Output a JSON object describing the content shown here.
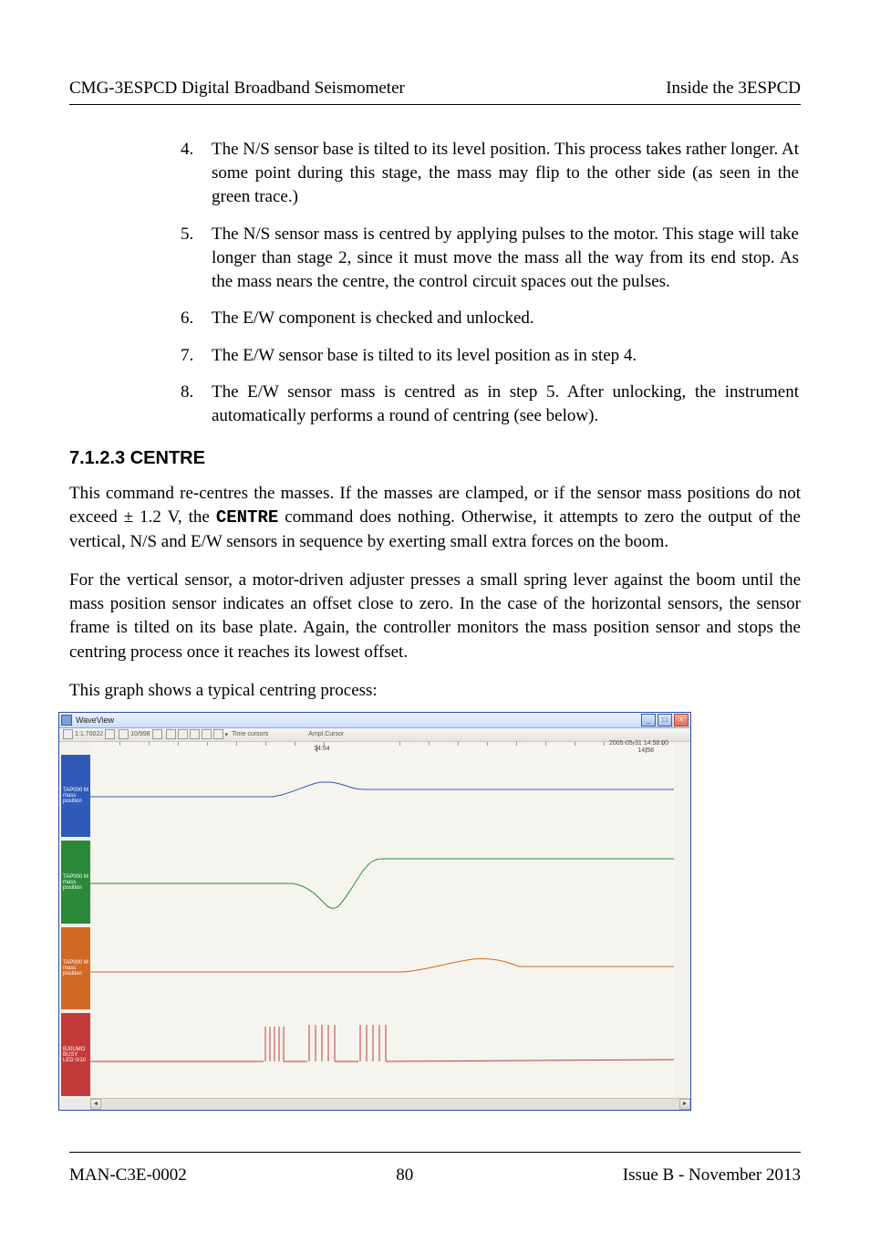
{
  "header": {
    "left": "CMG-3ESPCD Digital Broadband Seismometer",
    "right": "Inside the 3ESPCD"
  },
  "steps": {
    "s4": "The N/S sensor base is tilted to its level position. This process takes rather longer.  At some point during this stage, the mass may flip to the other side (as seen in the green trace.)",
    "s5": "The N/S sensor mass is centred by applying pulses to the motor.  This stage will take longer than stage 2, since it must move the mass all the way from its end stop.  As the mass nears the centre, the control circuit spaces out the pulses.",
    "s6": "The E/W component is checked and unlocked.",
    "s7": "The E/W sensor base is tilted to its level position as in step 4.",
    "s8": "The E/W sensor mass is centred as in step 5.  After unlocking, the instrument automatically performs a round of centring (see below)."
  },
  "section": {
    "number": "7.1.2.3",
    "title": "CENTRE"
  },
  "paragraphs": {
    "p1a": "This command re-centres the masses.  If the masses are clamped, or if the sensor mass positions do not exceed ± 1.2 V, the ",
    "p1b": "CENTRE",
    "p1c": " command does nothing.  Otherwise, it attempts to zero the output of the vertical, N/S and E/W sensors in sequence by exerting small extra forces on the boom.",
    "p2": "For the vertical sensor, a motor-driven adjuster presses a small spring lever against the boom until the mass position sensor indicates an offset close to zero.  In the case of the horizontal sensors, the sensor frame is tilted on its base plate.  Again, the controller monitors the mass position sensor and stops the centring process once it reaches its lowest offset.",
    "p3": "This graph shows a typical centring process:"
  },
  "waveview": {
    "title": "WaveView",
    "toolbar": {
      "zoom": "1:1.70022",
      "sampling": "10/998",
      "cursors": "Time cursors",
      "mode": "Ampl.Cursor"
    },
    "axis": {
      "left_time": "14:54",
      "right_date": "2005-05-31  14:58:00",
      "right_time": "14:58"
    },
    "labels": {
      "ch1": "TAP000 M mass position",
      "ch2": "TAP000 M mass position",
      "ch3": "TAP000 M mass position",
      "ch4": "BJ0UMO BUSY LED 0/10"
    }
  },
  "footer": {
    "left": "MAN-C3E-0002",
    "center": "80",
    "right": "Issue B  - November 2013"
  }
}
